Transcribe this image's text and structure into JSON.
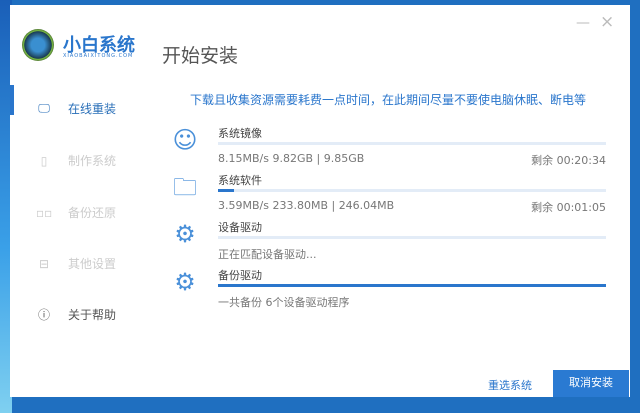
{
  "brand": {
    "name": "小白系统",
    "sub": "XIAOBAIXITONG.COM"
  },
  "title": "开始安装",
  "window": {
    "minimize": "—",
    "close": "×"
  },
  "sidebar": {
    "items": [
      {
        "label": "在线重装",
        "icon": "monitor-icon"
      },
      {
        "label": "制作系统",
        "icon": "usb-icon"
      },
      {
        "label": "备份还原",
        "icon": "grid-icon"
      },
      {
        "label": "其他设置",
        "icon": "briefcase-icon"
      },
      {
        "label": "关于帮助",
        "icon": "info-icon"
      }
    ]
  },
  "notice": "下载且收集资源需要耗费一点时间，在此期间尽量不要使电脑休眠、断电等",
  "tasks": [
    {
      "name": "系统镜像",
      "stat": "8.15MB/s 9.82GB | 9.85GB",
      "remaining": "剩余 00:20:34",
      "progress": 0
    },
    {
      "name": "系统软件",
      "stat": "3.59MB/s 233.80MB | 246.04MB",
      "remaining": "剩余 00:01:05",
      "progress": 4
    },
    {
      "name": "设备驱动",
      "stat": "正在匹配设备驱动...",
      "remaining": "",
      "progress": 0
    },
    {
      "name": "备份驱动",
      "stat": "一共备份 6个设备驱动程序",
      "remaining": "",
      "progress": 100
    }
  ],
  "buttons": {
    "reselect": "重选系统",
    "cancel": "取消安装"
  }
}
